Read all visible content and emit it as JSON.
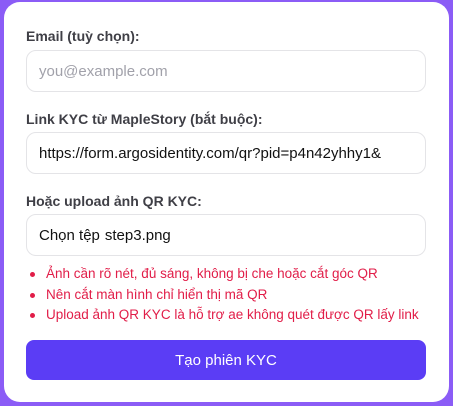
{
  "form": {
    "email": {
      "label": "Email (tuỳ chọn):",
      "placeholder": "you@example.com",
      "value": ""
    },
    "kyc_link": {
      "label": "Link KYC từ MapleStory (bắt buộc):",
      "value": "https://form.argosidentity.com/qr?pid=p4n42yhhy1&"
    },
    "qr_upload": {
      "label": "Hoặc upload ảnh QR KYC:",
      "button_label": "Chọn tệp",
      "file_name": "step3.png"
    },
    "notes": [
      "Ảnh cần rõ nét, đủ sáng, không bị che hoặc cắt góc QR",
      "Nên cắt màn hình chỉ hiển thị mã QR",
      "Upload ảnh QR KYC là hỗ trợ ae không quét được QR lấy link"
    ],
    "submit_label": "Tạo phiên KYC"
  }
}
